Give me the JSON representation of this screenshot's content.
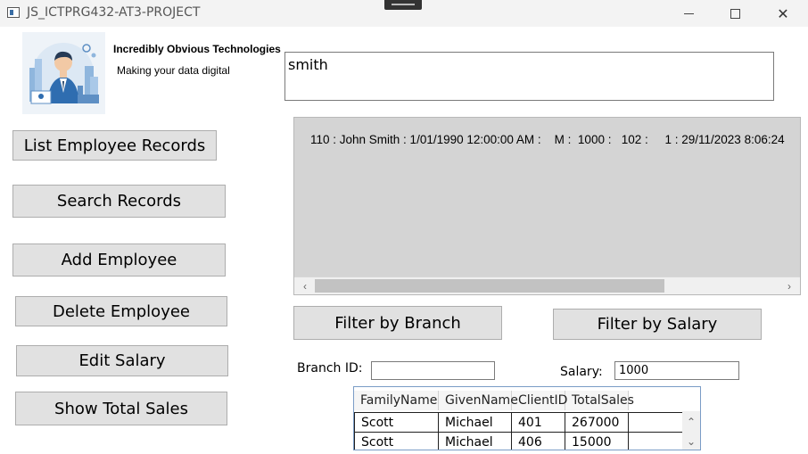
{
  "window": {
    "title": "JS_ICTPRG432-AT3-PROJECT",
    "close_glyph": "✕"
  },
  "branding": {
    "company_name": "Incredibly Obvious Technologies",
    "tagline": "Making your data digital",
    "logo_icon": "businessman-illustration"
  },
  "search": {
    "value": "smith"
  },
  "actions": {
    "list_employee_records": "List Employee Records",
    "search_records": "Search Records",
    "add_employee": "Add Employee",
    "delete_employee": "Delete Employee",
    "edit_salary": "Edit Salary",
    "show_total_sales": "Show Total Sales"
  },
  "output": {
    "line": "110 : John Smith : 1/01/1990 12:00:00 AM :    M :  1000 :   102 :     1 : 29/11/2023 8:06:24",
    "scroll_left": "‹",
    "scroll_right": "›"
  },
  "filters": {
    "filter_branch": "Filter by Branch",
    "filter_salary": "Filter by Salary",
    "branch_label": "Branch ID:",
    "branch_value": "",
    "salary_label": "Salary:",
    "salary_value": "1000"
  },
  "sales_grid": {
    "columns": [
      "FamilyName",
      "GivenName",
      "ClientID",
      "TotalSales"
    ],
    "rows": [
      [
        "Scott",
        "Michael",
        "401",
        "267000"
      ],
      [
        "Scott",
        "Michael",
        "406",
        "15000"
      ]
    ],
    "scroll_up": "⌃",
    "scroll_down": "⌄"
  }
}
